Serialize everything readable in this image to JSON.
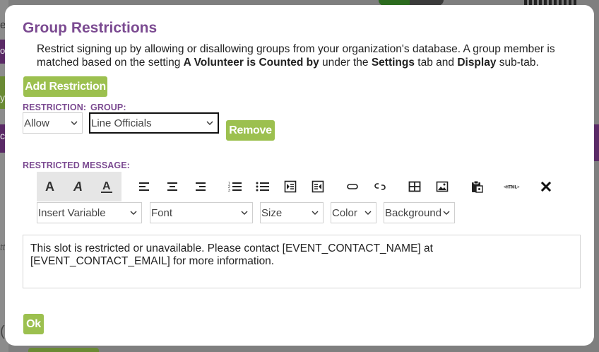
{
  "background": {
    "left_fragments": [
      "e",
      "o",
      "y",
      "ci",
      "tt",
      "(("
    ]
  },
  "dialog": {
    "title": "Group Restrictions",
    "description_parts": {
      "p1": "Restrict signing up by allowing or disallowing groups from your organization's database. A group member is matched based on the setting ",
      "b1": "A Volunteer is Counted by",
      "p2": " under the ",
      "b2": "Settings",
      "p3": " tab and ",
      "b3": "Display",
      "p4": " sub-tab."
    },
    "add_restriction_label": "Add Restriction",
    "restriction_label": "RESTRICTION:",
    "group_label": "GROUP:",
    "restriction_value": "Allow",
    "group_value": "Line Officials",
    "remove_label": "Remove",
    "restricted_message_label": "RESTRICTED MESSAGE:",
    "editor": {
      "toolbar_icons": [
        "bold-icon",
        "italic-icon",
        "underline-icon",
        "align-left-icon",
        "align-center-icon",
        "align-right-icon",
        "ordered-list-icon",
        "unordered-list-icon",
        "indent-icon",
        "outdent-icon",
        "link-icon",
        "unlink-icon",
        "table-icon",
        "image-icon",
        "paste-icon",
        "html-icon",
        "clear-format-icon"
      ],
      "html_icon_text": "HTML",
      "insert_variable": "Insert Variable",
      "font": "Font",
      "size": "Size",
      "color": "Color",
      "background": "Background",
      "content": "This slot is restricted or unavailable. Please contact [EVENT_CONTACT_NAME] at [EVENT_CONTACT_EMAIL] for more information."
    },
    "ok_label": "Ok"
  },
  "colors": {
    "accent_purple": "#7b4a91",
    "button_green": "#9cc04f"
  }
}
